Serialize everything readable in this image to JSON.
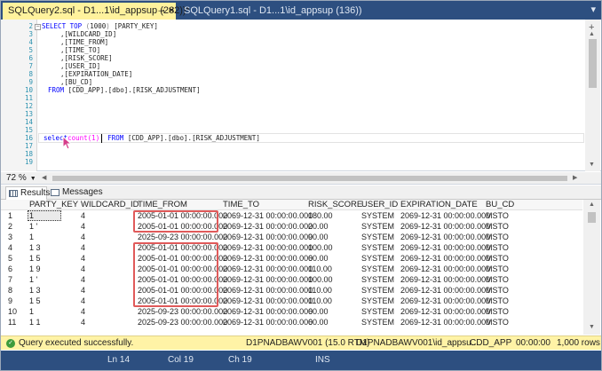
{
  "tabs": {
    "active_title": "SQLQuery2.sql - D1...1\\id_appsup (262))*",
    "inactive_title": "SQLQuery1.sql - D1...1\\id_appsup (136))"
  },
  "editor": {
    "line_numbers": [
      "2",
      "3",
      "4",
      "5",
      "6",
      "7",
      "8",
      "9",
      "10",
      "11",
      "12",
      "13",
      "14",
      "15",
      "16",
      "17",
      "18",
      "19"
    ],
    "sql_select": "SELECT TOP (1000) [PARTY_KEY]",
    "sql_cols": [
      ",[WILDCARD_ID]",
      ",[TIME_FROM]",
      ",[TIME_TO]",
      ",[RISK_SCORE]",
      ",[USER_ID]",
      ",[EXPIRATION_DATE]",
      ",[BU_CD]"
    ],
    "sql_from": "FROM [CDD_APP].[dbo].[RISK_ADJUSTMENT]",
    "line14_select": "select",
    "line14_count": "count(1)",
    "line14_from": "FROM [CDD_APP].[dbo].[RISK_ADJUSTMENT]"
  },
  "zoom": "72 %",
  "result_tabs": {
    "results": "Results",
    "messages": "Messages"
  },
  "grid": {
    "columns": [
      "PARTY_KEY",
      "WILDCARD_ID",
      "TIME_FROM",
      "TIME_TO",
      "RISK_SCORE",
      "USER_ID",
      "EXPIRATION_DATE",
      "BU_CD"
    ],
    "rows": [
      {
        "n": "1",
        "pk": "1",
        "wid": "4",
        "tf": "2005-01-01 00:00:00.000",
        "tt": "2069-12-31 00:00:00.000",
        "rs": "180.00",
        "uid": "SYSTEM",
        "exp": "2069-12-31 00:00:00.000",
        "bu": "MSTO"
      },
      {
        "n": "2",
        "pk": "1  '",
        "wid": "4",
        "tf": "2005-01-01 00:00:00.000",
        "tt": "2069-12-31 00:00:00.000",
        "rs": "20.00",
        "uid": "SYSTEM",
        "exp": "2069-12-31 00:00:00.000",
        "bu": "MSTO"
      },
      {
        "n": "3",
        "pk": "1",
        "wid": "4",
        "tf": "2025-09-23 00:00:00.000",
        "tt": "2069-12-31 00:00:00.000",
        "rs": "90.00",
        "uid": "SYSTEM",
        "exp": "2069-12-31 00:00:00.000",
        "bu": "MSTO"
      },
      {
        "n": "4",
        "pk": "1  3",
        "wid": "4",
        "tf": "2005-01-01 00:00:00.000",
        "tt": "2069-12-31 00:00:00.000",
        "rs": "100.00",
        "uid": "SYSTEM",
        "exp": "2069-12-31 00:00:00.000",
        "bu": "MSTO"
      },
      {
        "n": "5",
        "pk": "1  5",
        "wid": "4",
        "tf": "2005-01-01 00:00:00.000",
        "tt": "2069-12-31 00:00:00.000",
        "rs": "60.00",
        "uid": "SYSTEM",
        "exp": "2069-12-31 00:00:00.000",
        "bu": "MSTO"
      },
      {
        "n": "6",
        "pk": "1  9",
        "wid": "4",
        "tf": "2005-01-01 00:00:00.000",
        "tt": "2069-12-31 00:00:00.000",
        "rs": "110.00",
        "uid": "SYSTEM",
        "exp": "2069-12-31 00:00:00.000",
        "bu": "MSTO"
      },
      {
        "n": "7",
        "pk": "1  '",
        "wid": "4",
        "tf": "2005-01-01 00:00:00.000",
        "tt": "2069-12-31 00:00:00.000",
        "rs": "100.00",
        "uid": "SYSTEM",
        "exp": "2069-12-31 00:00:00.000",
        "bu": "MSTO"
      },
      {
        "n": "8",
        "pk": "1  3",
        "wid": "4",
        "tf": "2005-01-01 00:00:00.000",
        "tt": "2069-12-31 00:00:00.000",
        "rs": "110.00",
        "uid": "SYSTEM",
        "exp": "2069-12-31 00:00:00.000",
        "bu": "MSTO"
      },
      {
        "n": "9",
        "pk": "1  5",
        "wid": "4",
        "tf": "2005-01-01 00:00:00.000",
        "tt": "2069-12-31 00:00:00.000",
        "rs": "110.00",
        "uid": "SYSTEM",
        "exp": "2069-12-31 00:00:00.000",
        "bu": "MSTO"
      },
      {
        "n": "10",
        "pk": "1",
        "wid": "4",
        "tf": "2025-09-23 00:00:00.000",
        "tt": "2069-12-31 00:00:00.000",
        "rs": "60.00",
        "uid": "SYSTEM",
        "exp": "2069-12-31 00:00:00.000",
        "bu": "MSTO"
      },
      {
        "n": "11",
        "pk": "1  1",
        "wid": "4",
        "tf": "2025-09-23 00:00:00.000",
        "tt": "2069-12-31 00:00:00.000",
        "rs": "60.00",
        "uid": "SYSTEM",
        "exp": "2069-12-31 00:00:00.000",
        "bu": "MSTO"
      }
    ]
  },
  "query_status": {
    "message": "Query executed successfully.",
    "server": "D1PNADBAWV001 (15.0 RTM)",
    "user": "D1PNADBAWV001\\id_appsu...",
    "database": "CDD_APP",
    "elapsed": "00:00:00",
    "rows": "1,000 rows"
  },
  "status_bar": {
    "ln": "Ln 14",
    "col": "Col 19",
    "ch": "Ch 19",
    "mode": "INS"
  },
  "colors": {
    "title_bar": "#2d4f80",
    "active_tab": "#fff29d",
    "highlight_box": "#e05a5a",
    "status_bg": "#fff3a6"
  }
}
